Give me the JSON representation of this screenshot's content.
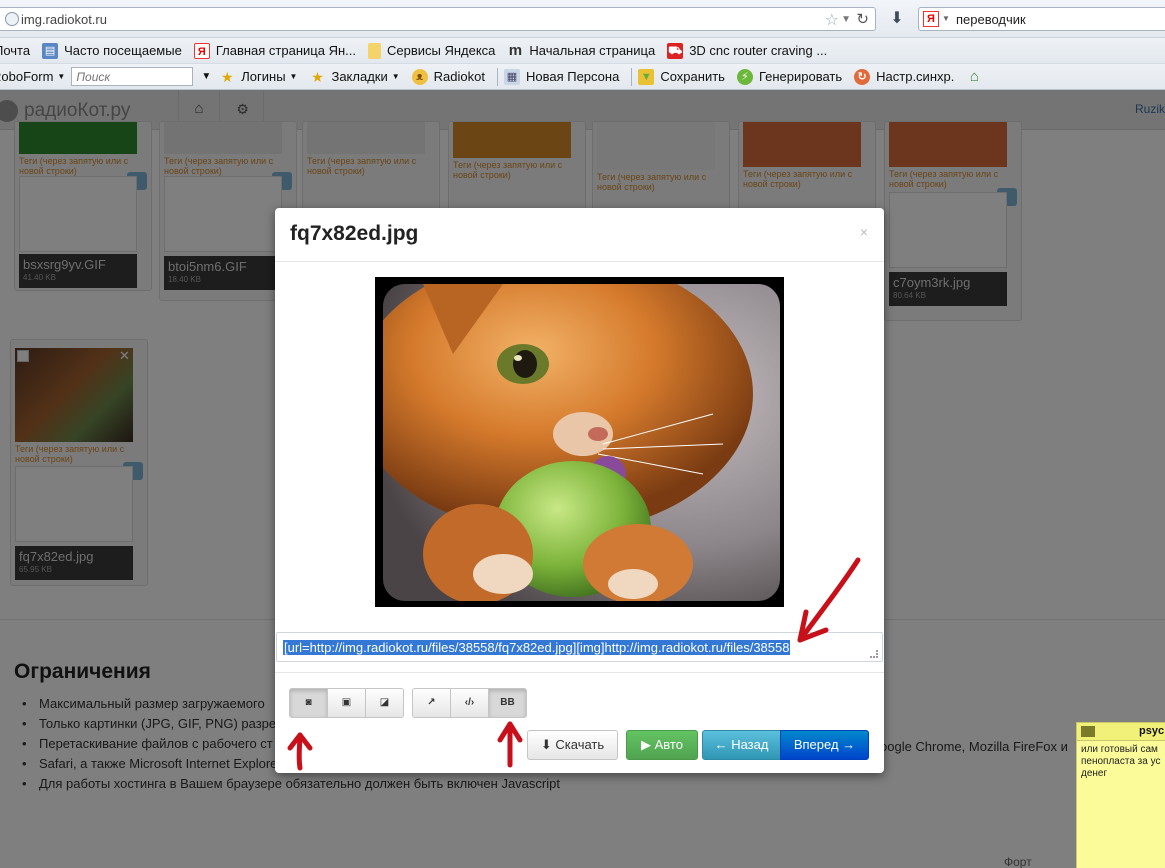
{
  "browser": {
    "url": "img.radiokot.ru",
    "search_text": "переводчик",
    "search_logo": "Я",
    "bookmarks_row1": [
      {
        "label": "Почта",
        "icon": "mail-icon"
      },
      {
        "label": "Часто посещаемые",
        "icon": "page-icon"
      },
      {
        "label": "Главная страница Ян...",
        "icon": "yandex-icon"
      },
      {
        "label": "Сервисы Яндекса",
        "icon": "folder-icon"
      },
      {
        "label": "Начальная страница",
        "icon": "m-icon"
      },
      {
        "label": "3D cnc router craving ...",
        "icon": "cart-icon"
      }
    ],
    "bookmarks_row2": {
      "roboform": "RoboForm",
      "search_placeholder": "Поиск",
      "logins": "Логины",
      "bookmarks": "Закладки",
      "radiokot": "Radiokot",
      "new_persona": "Новая Персона",
      "save": "Сохранить",
      "generate": "Генерировать",
      "sync": "Настр.синхр."
    }
  },
  "site": {
    "logo": "радиоКот.ру",
    "user": "Ruzik"
  },
  "thumbnails": [
    {
      "name": "bsxsrg9yv.GIF",
      "size": "41.40 KB",
      "tags": "Теги (через запятую или с новой строки)"
    },
    {
      "name": "btoi5nm6.GIF",
      "size": "18.40 KB",
      "tags": "Теги (через запятую или с новой строки)"
    },
    {
      "name": "",
      "size": "",
      "tags": "Теги (через запятую или с новой строки)"
    },
    {
      "name": "",
      "size": "",
      "tags": "Теги (через запятую или с новой строки)"
    },
    {
      "name": "",
      "size": "",
      "tags": "Теги (через запятую или с новой строки)"
    },
    {
      "name": "",
      "size": "",
      "tags": "Теги (через запятую или с новой строки)"
    },
    {
      "name": "c7oym3rk.jpg",
      "size": "80.64 KB",
      "tags": "Теги (через запятую или с новой строки)"
    },
    {
      "name": "fq7x82ed.jpg",
      "size": "65.95 KB",
      "tags": "Теги (через запятую или с новой строки)"
    }
  ],
  "restrictions": {
    "title": "Ограничения",
    "items": [
      "Максимальный размер загружаемого",
      "Только картинки (JPG, GIF, PNG) разре",
      "Перетаскивание файлов с рабочего ст",
      "Safari, а также Microsoft Internet Explorer 10.",
      "Для работы хостинга в Вашем браузере обязательно должен быть включен Javascript"
    ],
    "right_fragment": "oogle Chrome, Mozilla FireFox и",
    "footer_fragment": "Форт"
  },
  "sticky_note": {
    "title": "psyc",
    "text": "или готовый сам пенопласта за ус денег"
  },
  "modal": {
    "title": "fq7x82ed.jpg",
    "close": "×",
    "code_value": "[url=http://img.radiokot.ru/files/38558/fq7x82ed.jpg][img]http://img.radiokot.ru/files/38558",
    "group1": [
      "camera",
      "image",
      "small-image"
    ],
    "group2": [
      "external-link",
      "html",
      "BB"
    ],
    "buttons": {
      "download": "Скачать",
      "auto": "Авто",
      "back": "Назад",
      "forward": "Вперед"
    }
  }
}
